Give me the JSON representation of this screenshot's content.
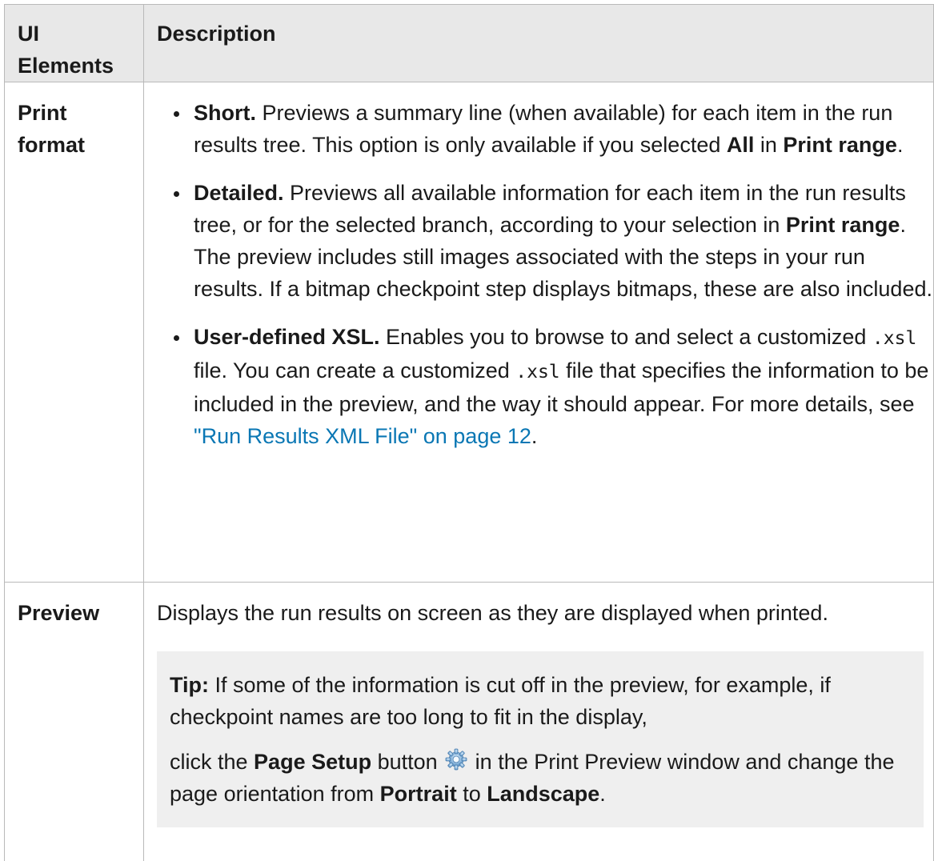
{
  "table": {
    "headers": [
      "UI Elements",
      "Description"
    ],
    "rows": [
      {
        "label": "Print format",
        "items": [
          {
            "lead": "Short.",
            "t1": " Previews a summary line (when available) for each item in the run results tree. This option is only available if you selected ",
            "b1": "All",
            "t2": " in ",
            "b2": "Print range",
            "t3": "."
          },
          {
            "lead": "Detailed.",
            "t1": " Previews all available information for each item in the run results tree, or for the selected branch, according to your selection in ",
            "b1": "Print range",
            "t2": ". The preview includes still images associated with the steps in your run results. If a bitmap checkpoint step displays bitmaps, these are also included."
          },
          {
            "lead": "User-defined XSL.",
            "t1": " Enables you to browse to and select a customized ",
            "code1": ".xsl",
            "t2": " file. You can create a customized ",
            "code2": ".xsl",
            "t3": " file that specifies the information to be included in the preview, and the way it should appear. For more details, see ",
            "link": "\"Run Results XML File\" on page 12",
            "t4": "."
          }
        ]
      },
      {
        "label": "Preview",
        "text": "Displays the run results on screen as they are displayed when printed.",
        "tip": {
          "lead": "Tip:",
          "t1": " If some of the information is cut off in the preview, for example, if checkpoint names are too long to fit in the display,",
          "t2": "click the ",
          "b1": "Page Setup",
          "t3": " button ",
          "icon": "gear-icon",
          "t4": " in the Print Preview window and change the page orientation from ",
          "b2": "Portrait",
          "t5": " to ",
          "b3": "Landscape",
          "t6": "."
        }
      }
    ]
  },
  "colors": {
    "link": "#0a77b4",
    "header_bg": "#e8e8e8",
    "tip_bg": "#efefef",
    "border": "#b9b9b9"
  }
}
